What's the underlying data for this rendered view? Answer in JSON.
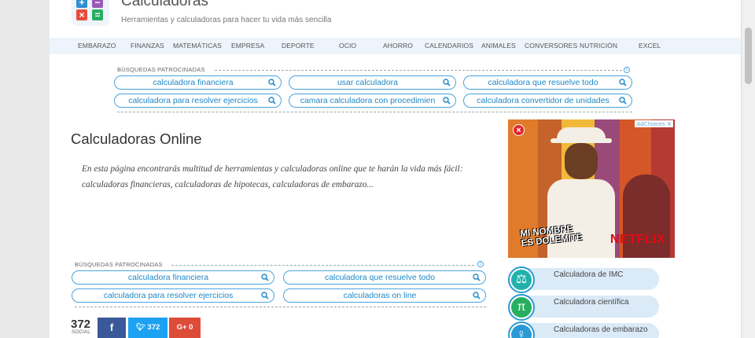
{
  "header": {
    "title": "Calculadoras",
    "subtitle": "Herramientas y calculadoras para hacer tu vida más sencilla"
  },
  "nav": [
    "EMBARAZO",
    "FINANZAS",
    "MATEMÁTICAS",
    "EMPRESA",
    "DEPORTE",
    "OCIO",
    "AHORRO",
    "CALENDARIOS",
    "ANIMALES",
    "CONVERSORES",
    "NUTRICIÓN",
    "EXCEL"
  ],
  "sponsored_top": {
    "label": "BÚSQUEDAS PATROCINADAS",
    "items": [
      "calculadora financiera",
      "usar calculadora",
      "calculadora que resuelve todo",
      "calculadora para resolver ejercicios",
      "camara calculadora con procedimien",
      "calculadora convertidor de unidades"
    ]
  },
  "main": {
    "title": "Calculadoras Online",
    "intro": "En esta página encontrarás multitud de herramientas y calculadoras online que te harán la vida más fácil: calculadoras financieras, calculadoras de hipotecas, calculadoras de embarazo..."
  },
  "sponsored_bottom": {
    "label": "BÚSQUEDAS PATROCINADAS",
    "items": [
      "calculadora financiera",
      "calculadora que resuelve todo",
      "calculadora para resolver ejercicios",
      "calculadoras on line"
    ]
  },
  "ad": {
    "adchoices": "AdChoices",
    "promo_line1": "MI NOMBRE",
    "promo_line2": "ES DOLEMITE",
    "brand": "NETFLIX"
  },
  "side_links": [
    {
      "label": "Calculadora de IMC",
      "icon": "scale-icon",
      "glyph": "⚖",
      "color": "#20b2aa"
    },
    {
      "label": "Calculadora científica",
      "icon": "pi-icon",
      "glyph": "π",
      "color": "#27ae60"
    },
    {
      "label": "Calculadoras de embarazo",
      "icon": "baby-icon",
      "glyph": "♀",
      "color": "#2a9ad4"
    }
  ],
  "social": {
    "count": "372",
    "count_label": "SOCIAL",
    "facebook": "f",
    "twitter": "372",
    "googleplus": "0"
  },
  "colors": {
    "accent": "#4aa3df",
    "facebook": "#3b5998",
    "twitter": "#1da1f2",
    "googleplus": "#dd4b39",
    "nav_bg": "#eef4fb"
  }
}
